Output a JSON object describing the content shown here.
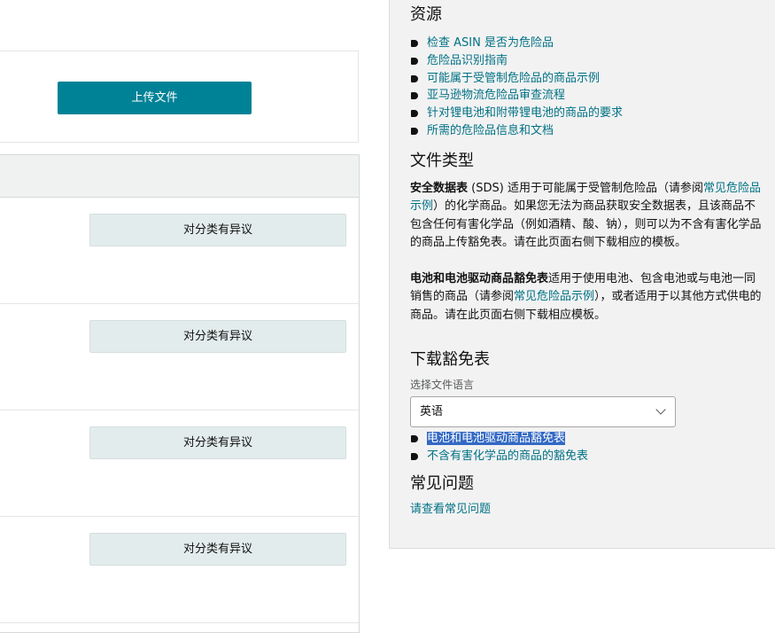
{
  "upload": {
    "button_label": "上传文件"
  },
  "classification_rows": [
    {
      "dispute_label": "对分类有异议"
    },
    {
      "dispute_label": "对分类有异议"
    },
    {
      "dispute_label": "对分类有异议"
    },
    {
      "dispute_label": "对分类有异议"
    }
  ],
  "resources": {
    "title": "资源",
    "links": [
      "检查 ASIN 是否为危险品",
      "危险品识别指南",
      "可能属于受管制危险品的商品示例",
      "亚马逊物流危险品审查流程",
      "针对锂电池和附带锂电池的商品的要求",
      "所需的危险品信息和文档"
    ]
  },
  "file_types": {
    "title": "文件类型",
    "sds": {
      "term": "安全数据表",
      "text_before_link": " (SDS) 适用于可能属于受管制危险品（请参阅",
      "link": "常见危险品示例",
      "text_after_link": "）的化学商品。如果您无法为商品获取安全数据表，且该商品不包含任何有害化学品（例如酒精、酸、钠），则可以为不含有害化学品的商品上传豁免表。请在此页面右侧下载相应的模板。"
    },
    "battery": {
      "term": "电池和电池驱动商品豁免表",
      "text_before_link": "适用于使用电池、包含电池或与电池一同销售的商品（请参阅",
      "link": "常见危险品示例",
      "text_after_link": "），或者适用于以其他方式供电的商品。请在此页面右侧下载相应模板。"
    }
  },
  "download": {
    "title": "下载豁免表",
    "language_label": "选择文件语言",
    "language_value": "英语",
    "links": [
      "电池和电池驱动商品豁免表",
      "不含有害化学品的商品的豁免表"
    ]
  },
  "faq": {
    "title": "常见问题",
    "link": "请查看常见问题"
  }
}
